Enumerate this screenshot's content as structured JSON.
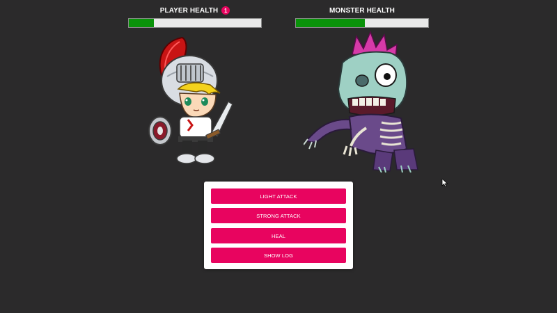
{
  "player": {
    "title": "PLAYER HEALTH",
    "badge": "1",
    "health_fraction": 0.19
  },
  "monster": {
    "title": "MONSTER HEALTH",
    "health_fraction": 0.52
  },
  "actions": {
    "light_attack": "LIGHT ATTACK",
    "strong_attack": "STRONG ATTACK",
    "heal": "HEAL",
    "show_log": "SHOW LOG"
  },
  "colors": {
    "background": "#2b2a2b",
    "accent": "#e8045f",
    "health_fill": "#0a920a",
    "health_track": "#e9e9e9"
  },
  "icons": {
    "player_sprite": "knight-sprite",
    "monster_sprite": "zombie-sprite",
    "pointer": "mouse-cursor-icon"
  }
}
